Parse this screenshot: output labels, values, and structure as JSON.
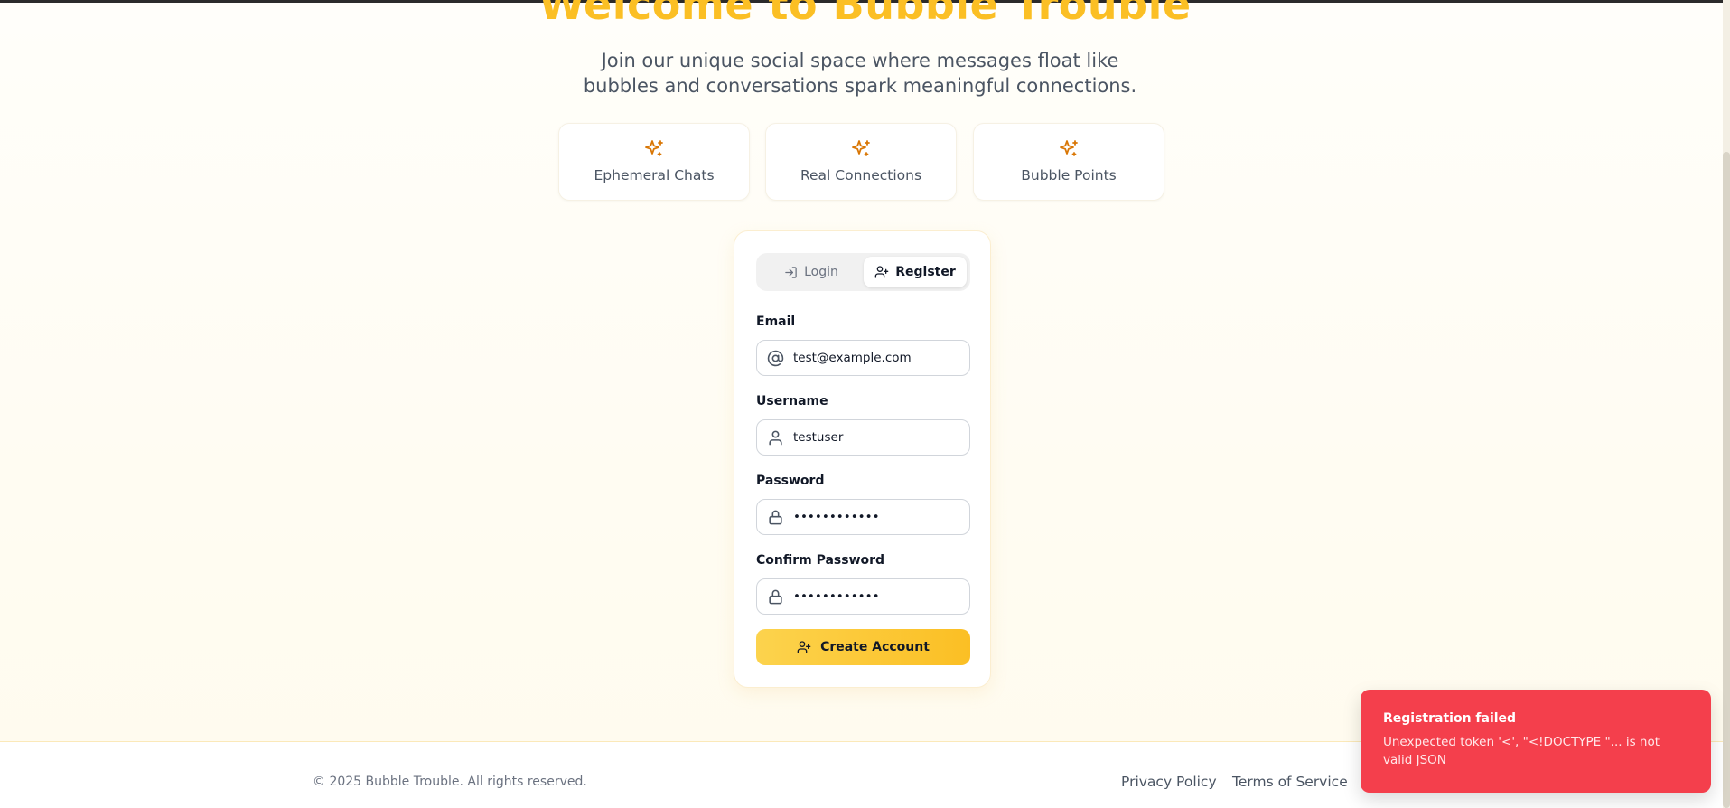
{
  "hero": {
    "title": "Welcome to Bubble Trouble",
    "subtitle": "Join our unique social space where messages float like bubbles and conversations spark meaningful connections."
  },
  "features": [
    {
      "icon": "sparkles-icon",
      "label": "Ephemeral Chats"
    },
    {
      "icon": "sparkles-icon",
      "label": "Real Connections"
    },
    {
      "icon": "sparkles-icon",
      "label": "Bubble Points"
    }
  ],
  "auth": {
    "tabs": {
      "login": "Login",
      "register": "Register",
      "active": "register"
    },
    "fields": {
      "email": {
        "label": "Email",
        "value": "test@example.com",
        "icon": "at-sign-icon"
      },
      "username": {
        "label": "Username",
        "value": "testuser",
        "icon": "user-icon"
      },
      "password": {
        "label": "Password",
        "value": "••••••••••••",
        "icon": "lock-icon"
      },
      "confirm_password": {
        "label": "Confirm Password",
        "value": "••••••••••••",
        "icon": "lock-icon"
      }
    },
    "submit_label": "Create Account"
  },
  "footer": {
    "copyright": "© 2025 Bubble Trouble. All rights reserved.",
    "links": {
      "privacy": "Privacy Policy",
      "terms": "Terms of Service"
    }
  },
  "toast": {
    "title": "Registration failed",
    "message": "Unexpected token '<', \"<!DOCTYPE \"... is not valid JSON"
  },
  "colors": {
    "accent": "#fbbf24",
    "toast_bg": "#f43f4c",
    "icon_orange": "#d97706"
  }
}
